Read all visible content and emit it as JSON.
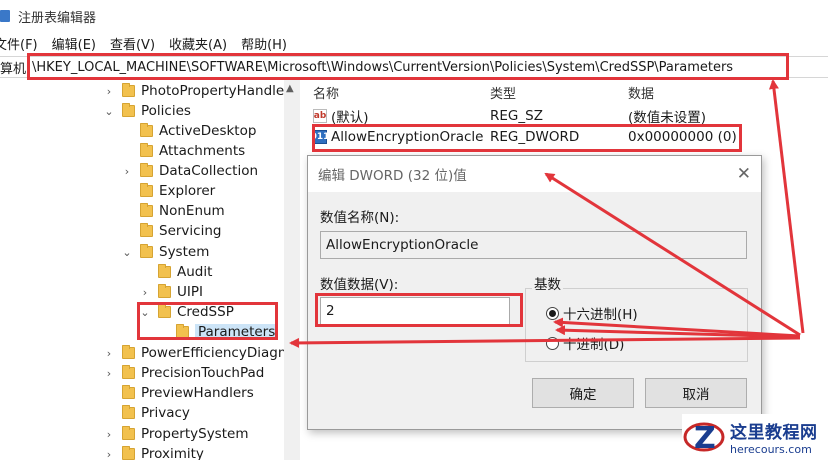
{
  "window": {
    "title": "注册表编辑器"
  },
  "menu": [
    "文件(F)",
    "编辑(E)",
    "查看(V)",
    "收藏夹(A)",
    "帮助(H)"
  ],
  "address": {
    "prefix": "计算机",
    "path": "\\HKEY_LOCAL_MACHINE\\SOFTWARE\\Microsoft\\Windows\\CurrentVersion\\Policies\\System\\CredSSP\\Parameters"
  },
  "tree": [
    {
      "label": "PhotoPropertyHandler",
      "arrow": "›"
    },
    {
      "label": "Policies",
      "arrow": "⌄"
    },
    {
      "label": "ActiveDesktop",
      "arrow": ""
    },
    {
      "label": "Attachments",
      "arrow": ""
    },
    {
      "label": "DataCollection",
      "arrow": "›"
    },
    {
      "label": "Explorer",
      "arrow": ""
    },
    {
      "label": "NonEnum",
      "arrow": ""
    },
    {
      "label": "Servicing",
      "arrow": ""
    },
    {
      "label": "System",
      "arrow": "⌄"
    },
    {
      "label": "Audit",
      "arrow": ""
    },
    {
      "label": "UIPI",
      "arrow": "›"
    },
    {
      "label": "CredSSP",
      "arrow": "⌄"
    },
    {
      "label": "Parameters",
      "arrow": ""
    },
    {
      "label": "PowerEfficiencyDiagnostics",
      "arrow": "›"
    },
    {
      "label": "PrecisionTouchPad",
      "arrow": "›"
    },
    {
      "label": "PreviewHandlers",
      "arrow": ""
    },
    {
      "label": "Privacy",
      "arrow": ""
    },
    {
      "label": "PropertySystem",
      "arrow": "›"
    },
    {
      "label": "Proximity",
      "arrow": "›"
    }
  ],
  "columns": {
    "name": "名称",
    "type": "类型",
    "data": "数据"
  },
  "rows": [
    {
      "icon_text": "ab",
      "name": "(默认)",
      "type": "REG_SZ",
      "data": "(数值未设置)"
    },
    {
      "icon_text": "011",
      "name": "AllowEncryptionOracle",
      "type": "REG_DWORD",
      "data": "0x00000000 (0)"
    }
  ],
  "dialog": {
    "title": "编辑 DWORD (32 位)值",
    "close": "✕",
    "name_label": "数值名称(N):",
    "name_value": "AllowEncryptionOracle",
    "data_label": "数值数据(V):",
    "data_value": "2",
    "base_label": "基数",
    "radio_hex": "十六进制(H)",
    "radio_dec": "十进制(D)",
    "ok": "确定",
    "cancel": "取消"
  },
  "watermark": {
    "text": "这里教程网",
    "url": "herecours.com"
  },
  "colors": {
    "annotation": "#e2353b",
    "selection": "#cce4f7",
    "folder": "#f2c14e"
  }
}
